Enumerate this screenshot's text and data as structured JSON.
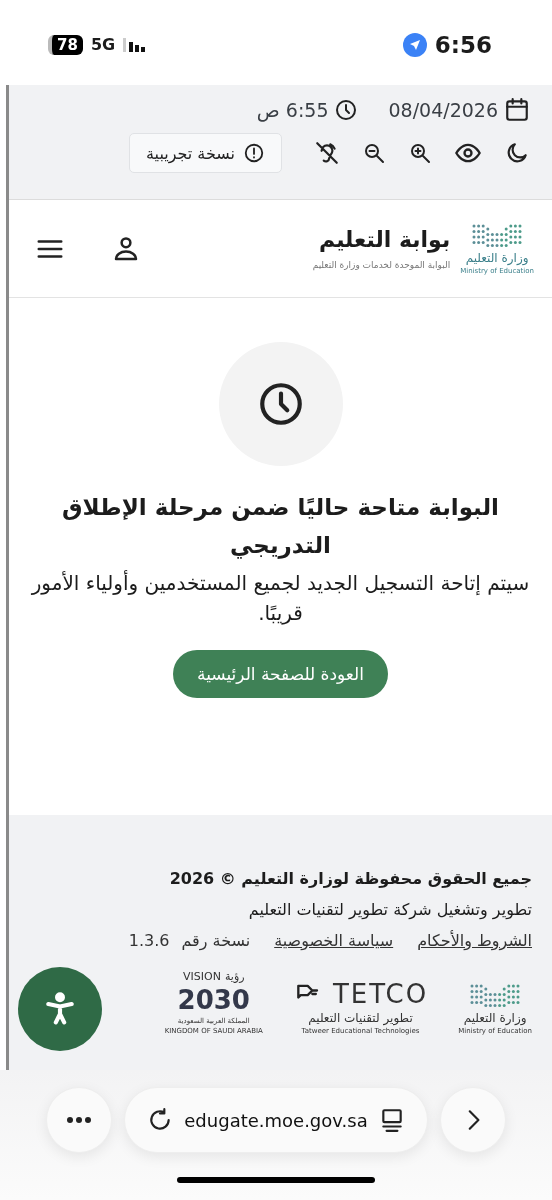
{
  "status_bar": {
    "battery": "78",
    "network": "5G",
    "time": "6:56"
  },
  "top_bar": {
    "date": "08/04/2026",
    "time": "6:55 ص",
    "beta_button": "نسخة تجريبية"
  },
  "header": {
    "ministry_logo": {
      "arabic": "وزارة التعليم",
      "english": "Ministry of Education"
    },
    "title": "بوابة التعليم",
    "subtitle": "البوابة الموحدة لخدمات وزارة التعليم"
  },
  "notice": {
    "heading": "البوابة متاحة حاليًا ضمن مرحلة الإطلاق التدريجي",
    "message": "سيتم إتاحة التسجيل الجديد لجميع المستخدمين وأولياء الأمور قريبًا.",
    "button": "العودة للصفحة الرئيسية"
  },
  "footer": {
    "copyright": "جميع الحقوق محفوظة لوزارة التعليم © 2026",
    "developer": "تطوير وتشغيل شركة تطوير لتقنيات التعليم",
    "links": [
      "الشروط والأحكام",
      "سياسة الخصوصية"
    ],
    "version_label": "نسخة رقم",
    "version": "1.3.6",
    "logos": {
      "ministry": {
        "arabic": "وزارة التعليم",
        "english": "Ministry of Education"
      },
      "tetco": {
        "name": "TETCO",
        "arabic": "تطوير لتقنيات التعليم",
        "english": "Tatweer Educational Technologies"
      },
      "vision": {
        "latin": "VISION",
        "arabic": "رؤية",
        "year": "2030",
        "country_ar": "المملكة العربية السعودية",
        "country_en": "KINGDOM OF SAUDI ARABIA"
      }
    }
  },
  "browser": {
    "url": "edugate.moe.gov.sa"
  }
}
